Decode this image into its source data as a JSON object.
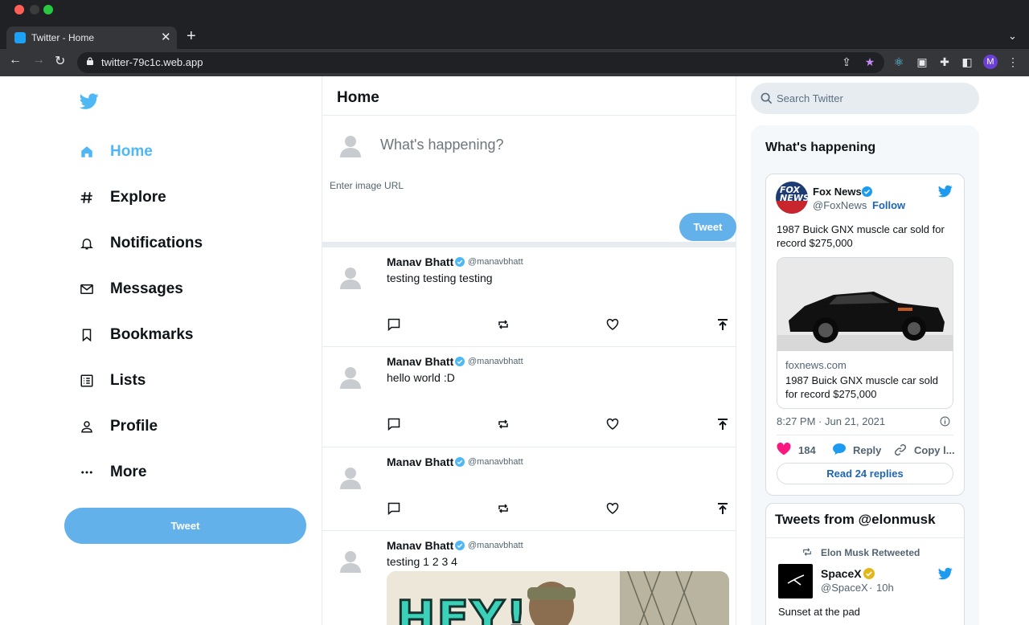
{
  "browser": {
    "tab_title": "Twitter - Home",
    "url": "twitter-79c1c.web.app",
    "profile_initial": "M"
  },
  "sidebar": {
    "items": [
      {
        "label": "Home",
        "icon": "home-icon",
        "active": true
      },
      {
        "label": "Explore",
        "icon": "hashtag-icon"
      },
      {
        "label": "Notifications",
        "icon": "bell-icon"
      },
      {
        "label": "Messages",
        "icon": "mail-icon"
      },
      {
        "label": "Bookmarks",
        "icon": "bookmark-icon"
      },
      {
        "label": "Lists",
        "icon": "list-icon"
      },
      {
        "label": "Profile",
        "icon": "person-icon"
      },
      {
        "label": "More",
        "icon": "more-icon"
      }
    ],
    "tweet_button": "Tweet"
  },
  "feed": {
    "title": "Home",
    "composer": {
      "placeholder": "What's happening?",
      "image_placeholder": "Enter image URL",
      "tweet_button": "Tweet"
    },
    "posts": [
      {
        "name": "Manav Bhatt",
        "handle": "@manavbhatt",
        "text": "testing testing testing"
      },
      {
        "name": "Manav Bhatt",
        "handle": "@manavbhatt",
        "text": "hello world :D"
      },
      {
        "name": "Manav Bhatt",
        "handle": "@manavbhatt",
        "text": ""
      },
      {
        "name": "Manav Bhatt",
        "handle": "@manavbhatt",
        "text": "testing 1 2 3 4",
        "image_text": "HEY!"
      }
    ]
  },
  "right": {
    "search_placeholder": "Search Twitter",
    "widget_title": "What's happening",
    "embed": {
      "account_name": "Fox News",
      "account_handle": "@FoxNews",
      "follow": "Follow",
      "text": "1987 Buick GNX muscle car sold for record $275,000",
      "link_domain": "foxnews.com",
      "link_title": "1987 Buick GNX muscle car sold for record $275,000",
      "timestamp": "8:27 PM · Jun 21, 2021",
      "likes": "184",
      "reply": "Reply",
      "copy": "Copy l...",
      "read_replies": "Read 24 replies"
    },
    "timeline": {
      "title": "Tweets from @elonmusk",
      "retweet_note": "Elon Musk Retweeted",
      "account_name": "SpaceX",
      "account_handle": "@SpaceX",
      "age": "10h",
      "text": "Sunset at the pad"
    }
  },
  "colors": {
    "twitter_blue": "#50b7f5",
    "tweet_button": "#62b1ea",
    "verified": "#1d9bf0"
  }
}
